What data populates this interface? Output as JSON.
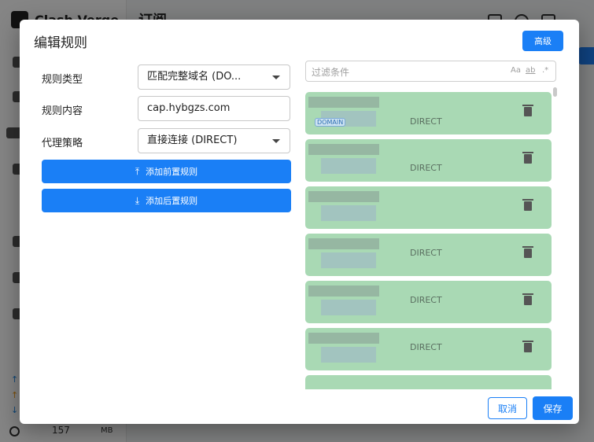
{
  "app": {
    "title": "Clash Verge",
    "header_title": "订阅",
    "memory_value": "157",
    "memory_unit": "MB",
    "accent_color": "#1a7ff6"
  },
  "dialog": {
    "title": "编辑规则",
    "advanced_label": "高级",
    "form": {
      "rule_type_label": "规则类型",
      "rule_type_value": "匹配完整域名 (DO...",
      "rule_content_label": "规则内容",
      "rule_content_value": "cap.hybgzs.com",
      "proxy_policy_label": "代理策略",
      "proxy_policy_value": "直接连接 (DIRECT)"
    },
    "add_prepend_label": "添加前置规则",
    "add_append_label": "添加后置规则",
    "filter": {
      "placeholder": "过滤条件",
      "match_case": "Aa",
      "match_word": "ab",
      "regex": ".*"
    },
    "rules": [
      {
        "proxy": "DIRECT",
        "tag": "DOMAIN",
        "card_color": "#a9d9b4"
      },
      {
        "proxy": "DIRECT",
        "tag": "",
        "card_color": "#a9d9b4"
      },
      {
        "proxy": "",
        "tag": "",
        "card_color": "#a9d9b4"
      },
      {
        "proxy": "DIRECT",
        "tag": "",
        "card_color": "#a9d9b4"
      },
      {
        "proxy": "DIRECT",
        "tag": "",
        "card_color": "#a9d9b4"
      },
      {
        "proxy": "DIRECT",
        "tag": "",
        "card_color": "#a9d9b4"
      }
    ],
    "cancel_label": "取消",
    "save_label": "保存"
  }
}
